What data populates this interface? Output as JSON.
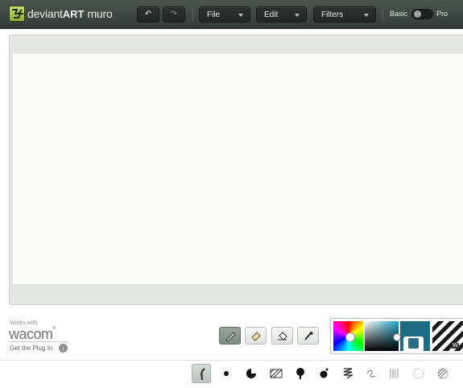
{
  "brand": {
    "prefix": "deviant",
    "bold": "ART",
    "suffix": "muro",
    "logo_icon": "deviantart-logo-icon"
  },
  "toolbar": {
    "undo_icon": "undo-icon",
    "redo_icon": "redo-icon",
    "menus": [
      {
        "label": "File"
      },
      {
        "label": "Edit"
      },
      {
        "label": "Filters"
      }
    ],
    "mode": {
      "left": "Basic",
      "right": "Pro",
      "selected": "Basic"
    }
  },
  "canvas": {
    "background": "#fcfdf7"
  },
  "wacom": {
    "works_with": "Works with",
    "brand": "wacom",
    "plugin_link": "Get the Plug In"
  },
  "tools": [
    {
      "name": "brush",
      "icon": "brush-icon",
      "active": true
    },
    {
      "name": "eraser",
      "icon": "eraser-icon",
      "active": false
    },
    {
      "name": "bucket",
      "icon": "paint-bucket-icon",
      "active": false
    },
    {
      "name": "picker",
      "icon": "eyedropper-icon",
      "active": false
    }
  ],
  "colors": {
    "swatch": "#1d6a82",
    "pattern_label": "W"
  },
  "brushes": [
    {
      "icon": "pencil-brush-icon",
      "active": true
    },
    {
      "icon": "round-brush-icon"
    },
    {
      "icon": "pie-brush-icon"
    },
    {
      "icon": "hatch-brush-icon"
    },
    {
      "icon": "drip-brush-icon"
    },
    {
      "icon": "splatter-brush-icon"
    },
    {
      "icon": "spring-brush-icon"
    },
    {
      "icon": "squiggle-brush-icon"
    },
    {
      "icon": "lines-brush-icon"
    },
    {
      "icon": "dots-brush-icon"
    },
    {
      "icon": "stripe-brush-icon"
    }
  ]
}
